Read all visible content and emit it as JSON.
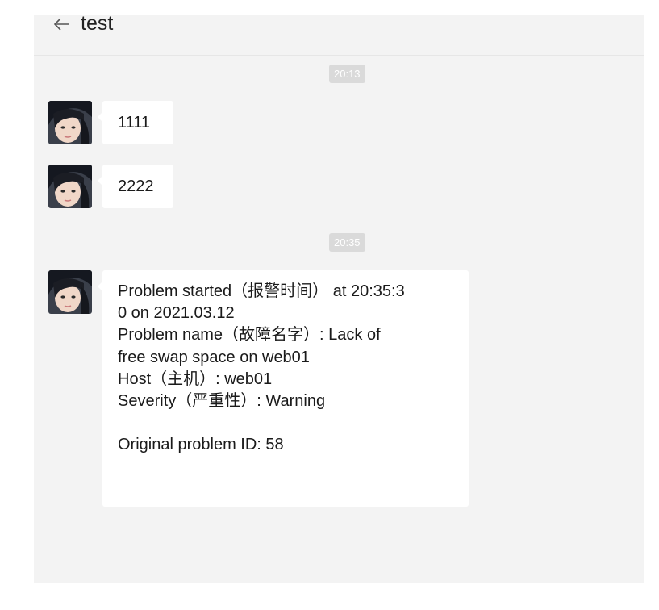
{
  "header": {
    "title": "test",
    "back_icon": "arrow-left-icon"
  },
  "messages": {
    "time_1": "20:13",
    "msg_1": "1111",
    "msg_2": "2222",
    "time_2": "20:35",
    "alert": {
      "line_1": "Problem started（报警时间） at 20:35:3",
      "line_2": "0 on 2021.03.12",
      "line_3": "Problem name（故障名字）: Lack of",
      "line_4": "free swap space on web01",
      "line_5": "Host（主机）: web01",
      "line_6": "Severity（严重性）: Warning",
      "line_7": "Original problem ID: 58"
    }
  },
  "colors": {
    "background": "#f3f3f3",
    "bubble": "#ffffff",
    "time_badge": "#dadada"
  }
}
